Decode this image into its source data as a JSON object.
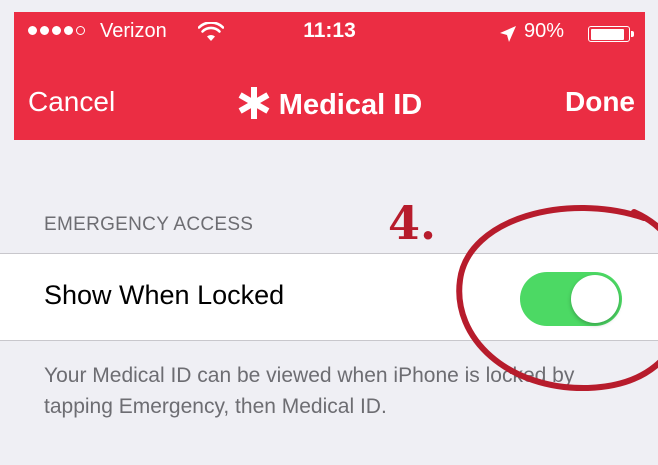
{
  "status_bar": {
    "carrier": "Verizon",
    "time": "11:13",
    "battery_percent": "90%",
    "battery_level": 0.9,
    "signal_bars_filled": 4,
    "signal_bars_total": 5
  },
  "nav": {
    "cancel_label": "Cancel",
    "title": "Medical ID",
    "done_label": "Done"
  },
  "section": {
    "header": "EMERGENCY ACCESS",
    "toggle_label": "Show When Locked",
    "toggle_on": true,
    "footer": "Your Medical ID can be viewed when iPhone is locked by tapping Emergency, then Medical ID."
  },
  "annotation": {
    "number": "4."
  },
  "colors": {
    "header_red": "#eb2d43",
    "toggle_green": "#4cd964",
    "annotation_red": "#b71c2c",
    "background": "#efeff4"
  },
  "icons": {
    "wifi": "wifi-icon",
    "location": "location-arrow-icon",
    "battery": "battery-icon",
    "medical": "medical-star-icon"
  }
}
